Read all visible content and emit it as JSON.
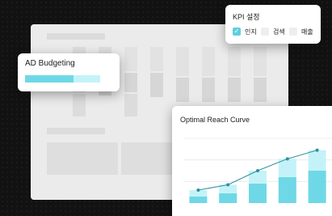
{
  "ad_budgeting": {
    "title": "AD Budgeting",
    "progress": 0.65
  },
  "kpi": {
    "title": "KPI 설정",
    "options": [
      {
        "label": "인지",
        "checked": true
      },
      {
        "label": "검색",
        "checked": false
      },
      {
        "label": "매출",
        "checked": false
      }
    ]
  },
  "reach": {
    "title": "Optimal Reach Curve"
  },
  "colors": {
    "accent": "#5ecfe0",
    "bar_light": "#c3f3f8",
    "bar_dark": "#6fd8e6",
    "line": "#2f8f9e"
  },
  "chart_data": {
    "type": "bar",
    "title": "Optimal Reach Curve",
    "categories": [
      "1",
      "2",
      "3",
      "4",
      "5"
    ],
    "series": [
      {
        "values": [
          6,
          9,
          18,
          24,
          30
        ]
      },
      {
        "values": [
          12,
          17,
          30,
          41,
          49
        ]
      },
      {
        "values": [
          12,
          17,
          30,
          41,
          49
        ]
      }
    ],
    "ylim": [
      0,
      60
    ],
    "grid": true
  }
}
